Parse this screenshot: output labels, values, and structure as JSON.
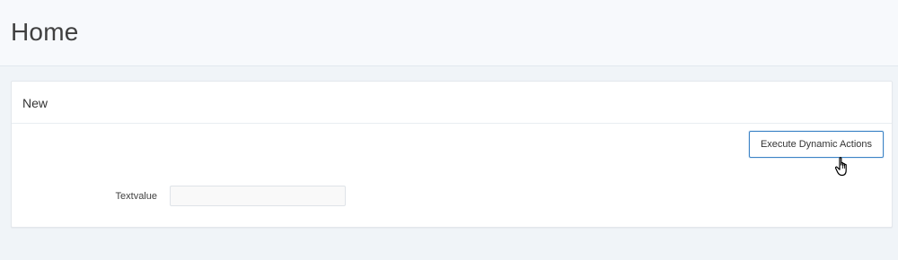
{
  "header": {
    "title": "Home"
  },
  "region": {
    "title": "New",
    "action_button_label": "Execute Dynamic Actions",
    "form": {
      "field_label": "Textvalue",
      "field_value": "",
      "field_placeholder": ""
    }
  },
  "cursor": {
    "icon": "hand-pointer-icon"
  },
  "colors": {
    "page_background": "#f0f4f8",
    "header_background": "#f7f9fc",
    "button_border": "#3d84c6",
    "region_background": "#ffffff"
  }
}
